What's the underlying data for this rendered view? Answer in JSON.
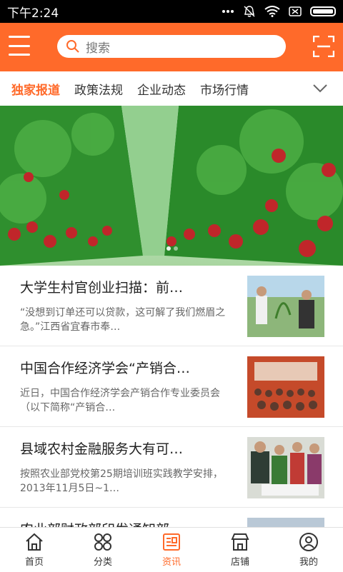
{
  "status": {
    "time": "下午2:24"
  },
  "header": {
    "menu_icon": "menu-icon",
    "search_placeholder": "搜索",
    "scan_icon": "scan-icon",
    "accent": "#ff6a2a"
  },
  "tabs": [
    {
      "label": "独家报道",
      "active": true
    },
    {
      "label": "政策法规",
      "active": false
    },
    {
      "label": "企业动态",
      "active": false
    },
    {
      "label": "市场行情",
      "active": false
    }
  ],
  "news": [
    {
      "title": "大学生村官创业扫描：前…",
      "summary": "“没想到订单还可以贷款，这可解了我们燃眉之急。”江西省宜春市奉…"
    },
    {
      "title": "中国合作经济学会“产销合…",
      "summary": "近日，中国合作经济学会产销合作专业委员会（以下简称“产销合…"
    },
    {
      "title": "县域农村金融服务大有可…",
      "summary": "按照农业部党校第25期培训班实践教学安排，2013年11月5日~1…"
    },
    {
      "title": "农业部财政部印发通知部…",
      "summary": ""
    }
  ],
  "bottom_nav": [
    {
      "label": "首页",
      "icon": "home-icon",
      "active": false
    },
    {
      "label": "分类",
      "icon": "category-icon",
      "active": false
    },
    {
      "label": "资讯",
      "icon": "news-icon",
      "active": true
    },
    {
      "label": "店铺",
      "icon": "store-icon",
      "active": false
    },
    {
      "label": "我的",
      "icon": "profile-icon",
      "active": false
    }
  ]
}
